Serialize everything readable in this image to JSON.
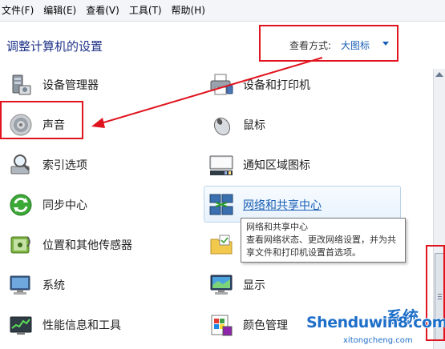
{
  "menu": [
    "文件(F)",
    "编辑(E)",
    "查看(V)",
    "工具(T)",
    "帮助(H)"
  ],
  "header": {
    "title": "调整计算机的设置",
    "view_label": "查看方式:",
    "view_value": "大图标"
  },
  "items_left": [
    {
      "label": "设备管理器",
      "icon": "device-manager-icon"
    },
    {
      "label": "声音",
      "icon": "speaker-icon"
    },
    {
      "label": "索引选项",
      "icon": "indexing-search-icon"
    },
    {
      "label": "同步中心",
      "icon": "sync-center-icon"
    },
    {
      "label": "位置和其他传感器",
      "icon": "location-sensor-icon"
    },
    {
      "label": "系统",
      "icon": "system-computer-icon"
    },
    {
      "label": "性能信息和工具",
      "icon": "performance-chart-icon"
    }
  ],
  "items_right": [
    {
      "label": "设备和打印机",
      "icon": "printer-icon"
    },
    {
      "label": "鼠标",
      "icon": "mouse-icon"
    },
    {
      "label": "通知区域图标",
      "icon": "notification-tray-icon"
    },
    {
      "label": "网络和共享中心",
      "icon": "network-sharing-icon"
    },
    {
      "label": "",
      "icon": "folder-icon"
    },
    {
      "label": "显示",
      "icon": "display-monitor-icon"
    },
    {
      "label": "颜色管理",
      "icon": "color-management-icon"
    }
  ],
  "tooltip": {
    "title": "网络和共享中心",
    "desc": "查看网络状态、更改网络设置，并为共享文件和打印机设置首选项。"
  },
  "watermark": {
    "main": "Shenduwin8.com",
    "sub": "xitongcheng.com",
    "net": "系统"
  },
  "colors": {
    "annotation": "#e0141e",
    "link": "#1a5fb4",
    "title": "#1e3287"
  }
}
